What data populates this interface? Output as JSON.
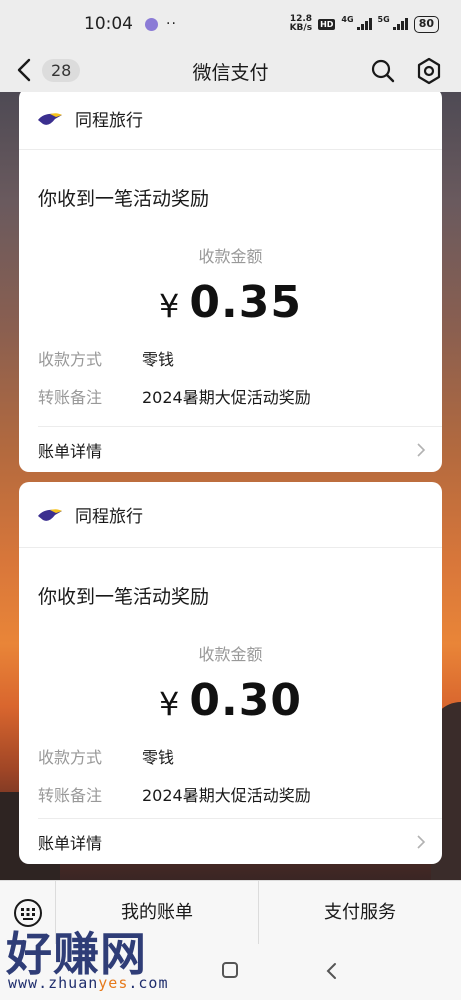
{
  "status_bar": {
    "time": "10:04",
    "more": "··",
    "net_speed_value": "12.8",
    "net_speed_unit": "KB/s",
    "hd": "HD",
    "net_4g": "4G",
    "net_5g": "5G",
    "battery": "80"
  },
  "header": {
    "back_count": "28",
    "title": "微信支付"
  },
  "cards": [
    {
      "brand": "同程旅行",
      "message": "你收到一笔活动奖励",
      "amount_label": "收款金额",
      "currency": "¥",
      "amount": "0.35",
      "method_label": "收款方式",
      "method_value": "零钱",
      "note_label": "转账备注",
      "note_value": "2024暑期大促活动奖励",
      "footer": "账单详情"
    },
    {
      "brand": "同程旅行",
      "message": "你收到一笔活动奖励",
      "amount_label": "收款金额",
      "currency": "¥",
      "amount": "0.30",
      "method_label": "收款方式",
      "method_value": "零钱",
      "note_label": "转账备注",
      "note_value": "2024暑期大促活动奖励",
      "footer": "账单详情"
    }
  ],
  "bottom_menu": {
    "items": [
      "我的账单",
      "支付服务"
    ]
  },
  "watermark": {
    "brand": "好赚网",
    "url_pre": "www.zhuan",
    "url_hl": "yes",
    "url_post": ".com"
  },
  "colors": {
    "brand_purple": "#3b2f8f",
    "brand_yellow": "#f5c21b"
  },
  "icons": [
    "chevron-left-icon",
    "search-icon",
    "gear-icon",
    "keyboard-icon",
    "chevron-right-icon",
    "home-icon",
    "back-icon"
  ]
}
